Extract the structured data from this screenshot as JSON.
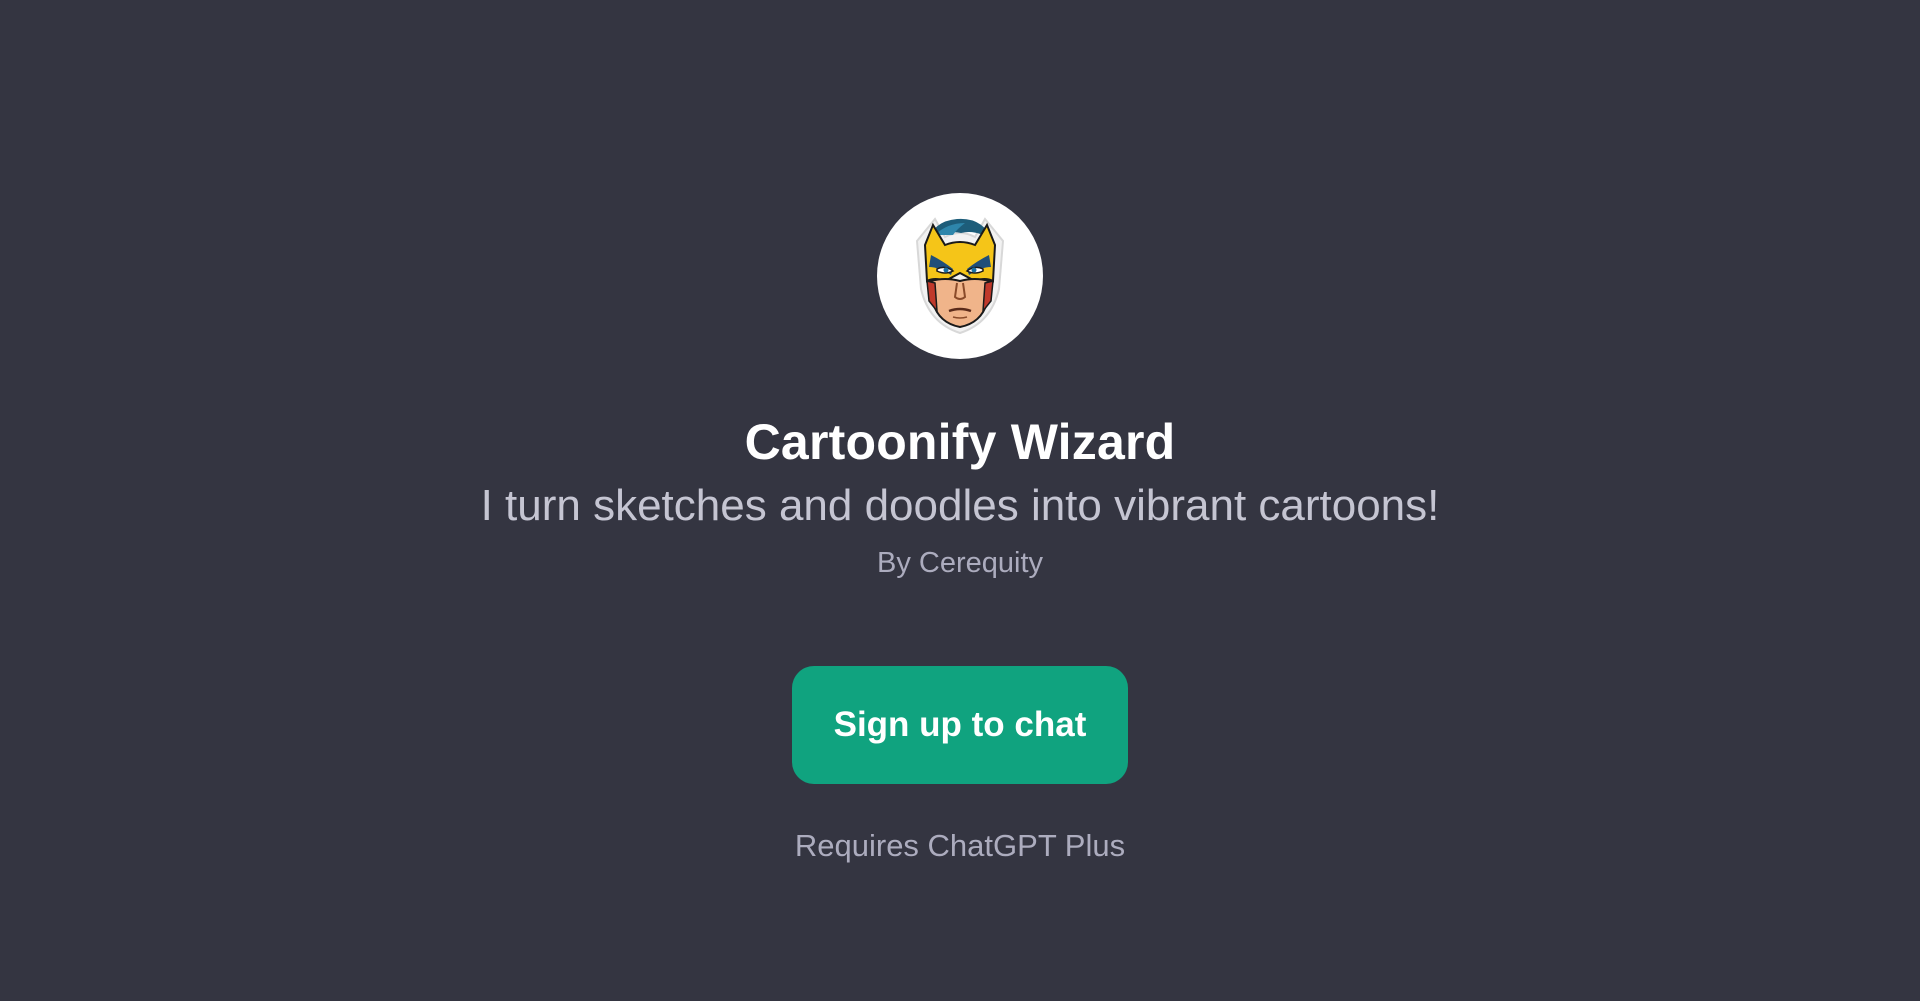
{
  "gpt": {
    "title": "Cartoonify Wizard",
    "description": "I turn sketches and doodles into vibrant cartoons!",
    "author": "By Cerequity",
    "avatar_icon": "superhero-mask-icon"
  },
  "actions": {
    "signup_label": "Sign up to chat"
  },
  "footer": {
    "requirement": "Requires ChatGPT Plus"
  },
  "colors": {
    "background": "#343541",
    "accent": "#10a37f",
    "title": "#ffffff",
    "subtitle": "#c5c5d2",
    "muted": "#acacbe"
  }
}
